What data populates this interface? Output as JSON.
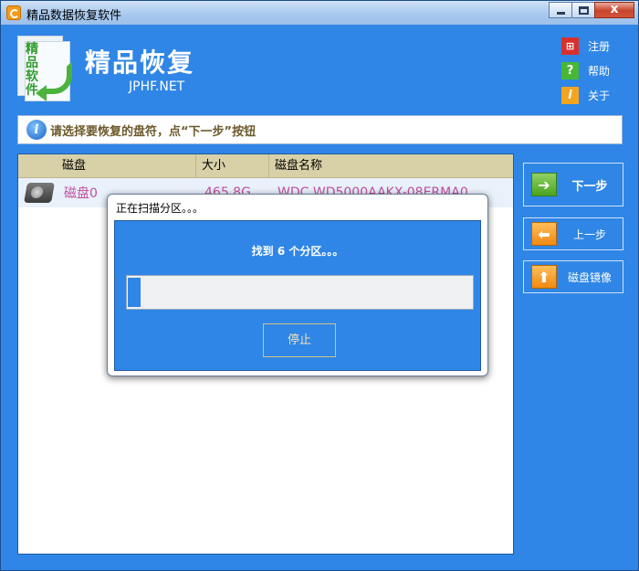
{
  "window": {
    "title": "精品数据恢复软件"
  },
  "header": {
    "logo_chars": [
      "精",
      "品",
      "软",
      "件"
    ],
    "brand": "精品恢复",
    "brand_sub": "JPHF.NET",
    "links": [
      {
        "label": "注册",
        "icon": "cart-icon",
        "glyph": "🛒"
      },
      {
        "label": "帮助",
        "icon": "question-icon",
        "glyph": "?"
      },
      {
        "label": "关于",
        "icon": "info-icon",
        "glyph": "i"
      }
    ]
  },
  "hint": {
    "text": "请选择要恢复的盘符，点“下一步”按钮"
  },
  "table": {
    "columns": [
      "磁盘",
      "大小",
      "磁盘名称"
    ],
    "rows": [
      {
        "name": "磁盘0",
        "size": "465.8G",
        "model": "WDC WD5000AAKX-08ERMA0"
      }
    ]
  },
  "side_buttons": {
    "next": "下一步",
    "prev": "上一步",
    "image": "磁盘镜像"
  },
  "dialog": {
    "title": "正在扫描分区。。。",
    "message": "找到 6 个分区。。。",
    "progress": 0.03,
    "stop_label": "停止"
  },
  "colors": {
    "accent": "#2f86e6",
    "header_row": "#d8d1a8",
    "disk_text": "#c04fa0",
    "hint_text": "#6c5a2c"
  }
}
